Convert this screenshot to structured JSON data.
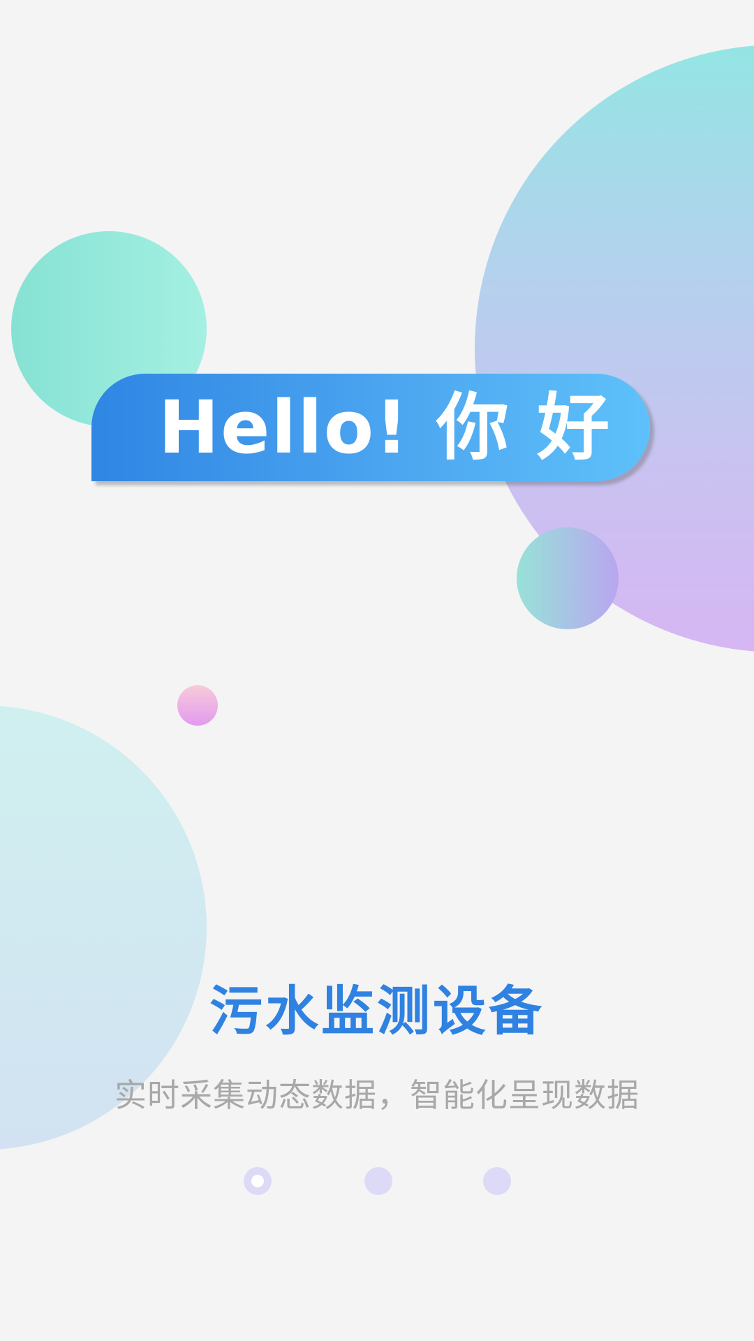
{
  "banner": {
    "greeting": "Hello! 你 好"
  },
  "intro": {
    "title": "污水监测设备",
    "subtitle": "实时采集动态数据，智能化呈现数据"
  },
  "pager": {
    "total_pages": 3,
    "current_page": 1
  },
  "colors": {
    "background": "#f4f4f4",
    "banner_start": "#2f86e4",
    "banner_end": "#5ec1fa",
    "title": "#2f82e1",
    "subtitle": "#a8a8a8",
    "dot": "#dcdaf6"
  }
}
